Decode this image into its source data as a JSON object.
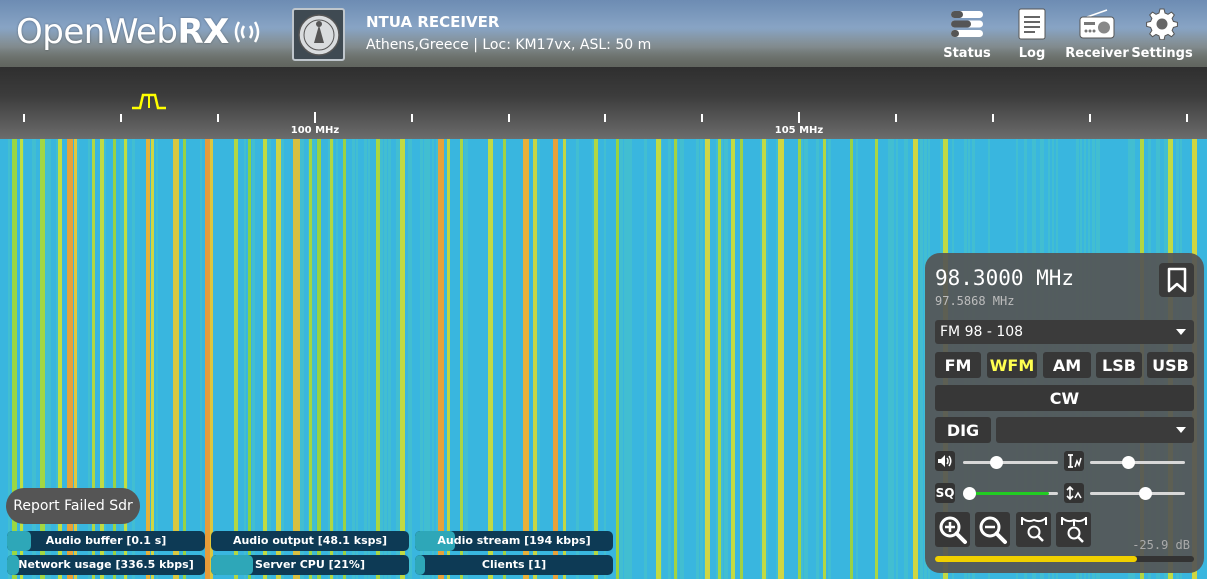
{
  "header": {
    "logo_light": "Open",
    "logo_mid": "Web",
    "logo_bold": "RX",
    "receiver_title": "NTUA RECEIVER",
    "receiver_desc": "Athens,Greece | Loc: KM17vx, ASL: 50 m",
    "nav": [
      {
        "label": "Status",
        "icon": "status-icon"
      },
      {
        "label": "Log",
        "icon": "log-icon"
      },
      {
        "label": "Receiver",
        "icon": "radio-icon"
      },
      {
        "label": "Settings",
        "icon": "gear-icon"
      }
    ]
  },
  "scale": {
    "labels": [
      "100 MHz",
      "105 MHz"
    ]
  },
  "panel": {
    "frequency": "98.3000 MHz",
    "offset_frequency": "97.5868 MHz",
    "profile": "FM 98 - 108",
    "modes": [
      "FM",
      "WFM",
      "AM",
      "LSB",
      "USB"
    ],
    "active_mode": "WFM",
    "cw_label": "CW",
    "dig_label": "DIG",
    "dig_selected": "",
    "sliders": {
      "volume": 0.35,
      "nr": 0.4,
      "squelch": 0.0,
      "squelch_fill": 0.9,
      "agc": 0.58
    },
    "smeter_value": "-25.9 dB",
    "smeter_level": 0.78
  },
  "report_button": "Report Failed Sdr",
  "progress": [
    {
      "label": "Audio buffer [0.1 s]",
      "level": 0.12
    },
    {
      "label": "Audio output [48.1 ksps]",
      "level": 0.0
    },
    {
      "label": "Audio stream [194 kbps]",
      "level": 0.2
    },
    {
      "label": "Network usage [336.5 kbps]",
      "level": 0.06
    },
    {
      "label": "Server CPU [21%]",
      "level": 0.21
    },
    {
      "label": "Clients [1]",
      "level": 0.05
    }
  ],
  "colors": {
    "waterfall_base": "#39b6df",
    "active_mode": "#ffff50",
    "smeter": "#f0d000",
    "progress_bg": "#0d3a55",
    "progress_fill": "#2ea7b8"
  }
}
